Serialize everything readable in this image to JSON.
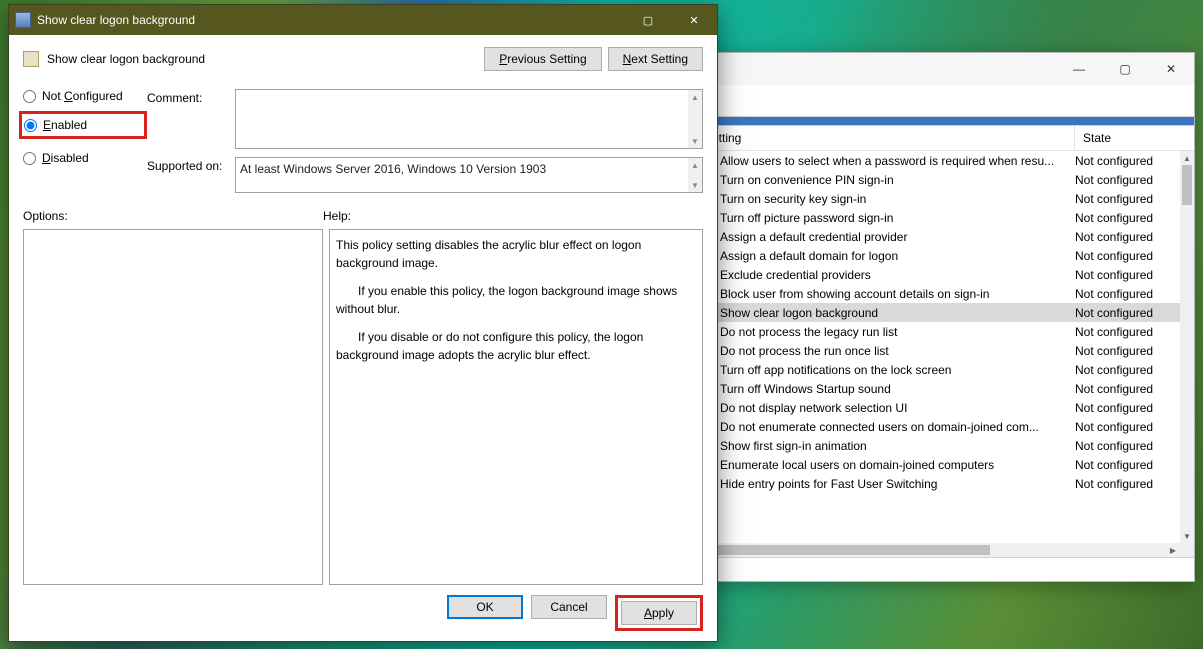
{
  "dialog": {
    "title": "Show clear logon background",
    "header_label": "Show clear logon background",
    "prev_button_leading": "P",
    "prev_button_rest": "revious Setting",
    "next_button_leading": "N",
    "next_button_rest": "ext Setting",
    "radio": {
      "not_configured_text": "Not ",
      "not_configured_u": "C",
      "not_configured_rest": "onfigured",
      "enabled_u": "E",
      "enabled_rest": "nabled",
      "disabled_u": "D",
      "disabled_rest": "isabled"
    },
    "comment_label": "Comment:",
    "comment_value": "",
    "supported_label": "Supported on:",
    "supported_value": "At least Windows Server 2016, Windows 10 Version 1903",
    "options_label": "Options:",
    "help_label": "Help:",
    "help_p1": "This policy setting disables the acrylic blur effect on logon background image.",
    "help_p2": "If you enable this policy, the logon background image shows without blur.",
    "help_p3": "If you disable or do not configure this policy, the logon background image adopts the acrylic blur effect.",
    "ok_label": "OK",
    "cancel_label": "Cancel",
    "apply_u": "A",
    "apply_rest": "pply"
  },
  "gpo": {
    "header_setting": "Setting",
    "header_state": "State",
    "rows": [
      {
        "setting": "Allow users to select when a password is required when resu...",
        "state": "Not configured",
        "sel": false
      },
      {
        "setting": "Turn on convenience PIN sign-in",
        "state": "Not configured",
        "sel": false
      },
      {
        "setting": "Turn on security key sign-in",
        "state": "Not configured",
        "sel": false
      },
      {
        "setting": "Turn off picture password sign-in",
        "state": "Not configured",
        "sel": false
      },
      {
        "setting": "Assign a default credential provider",
        "state": "Not configured",
        "sel": false
      },
      {
        "setting": "Assign a default domain for logon",
        "state": "Not configured",
        "sel": false
      },
      {
        "setting": "Exclude credential providers",
        "state": "Not configured",
        "sel": false
      },
      {
        "setting": "Block user from showing account details on sign-in",
        "state": "Not configured",
        "sel": false
      },
      {
        "setting": "Show clear logon background",
        "state": "Not configured",
        "sel": true
      },
      {
        "setting": "Do not process the legacy run list",
        "state": "Not configured",
        "sel": false
      },
      {
        "setting": "Do not process the run once list",
        "state": "Not configured",
        "sel": false
      },
      {
        "setting": "Turn off app notifications on the lock screen",
        "state": "Not configured",
        "sel": false
      },
      {
        "setting": "Turn off Windows Startup sound",
        "state": "Not configured",
        "sel": false
      },
      {
        "setting": "Do not display network selection UI",
        "state": "Not configured",
        "sel": false
      },
      {
        "setting": "Do not enumerate connected users on domain-joined com...",
        "state": "Not configured",
        "sel": false
      },
      {
        "setting": "Show first sign-in animation",
        "state": "Not configured",
        "sel": false
      },
      {
        "setting": "Enumerate local users on domain-joined computers",
        "state": "Not configured",
        "sel": false
      },
      {
        "setting": "Hide entry points for Fast User Switching",
        "state": "Not configured",
        "sel": false
      }
    ]
  }
}
